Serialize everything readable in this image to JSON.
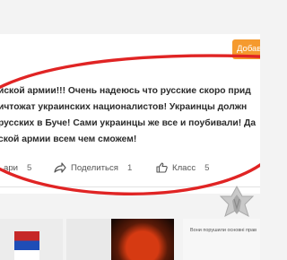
{
  "post": {
    "add_button_label": "Добав",
    "text_lines": [
      "йской армии!!! Очень надеюсь что русские скоро прид",
      "ичтожат украинских националистов! Украинцы должн",
      "русских в Буче! Сами украинцы же все и поубивали! Да",
      "ской армии всем чем сможем!"
    ]
  },
  "actions": {
    "comments": {
      "label": "ари",
      "count": "5"
    },
    "share": {
      "label": "Поделиться",
      "count": "1"
    },
    "like": {
      "label": "Класс",
      "count": "5"
    }
  },
  "thumbnails": {
    "caption_text": "Вони порушили основні прав"
  },
  "colors": {
    "accent_orange": "#f59a2e",
    "highlight_red": "#e02424",
    "text": "#2b2b2b"
  },
  "icons": {
    "share": "share-arrow-icon",
    "like": "thumbs-up-icon",
    "emblem": "police-emblem-icon"
  }
}
